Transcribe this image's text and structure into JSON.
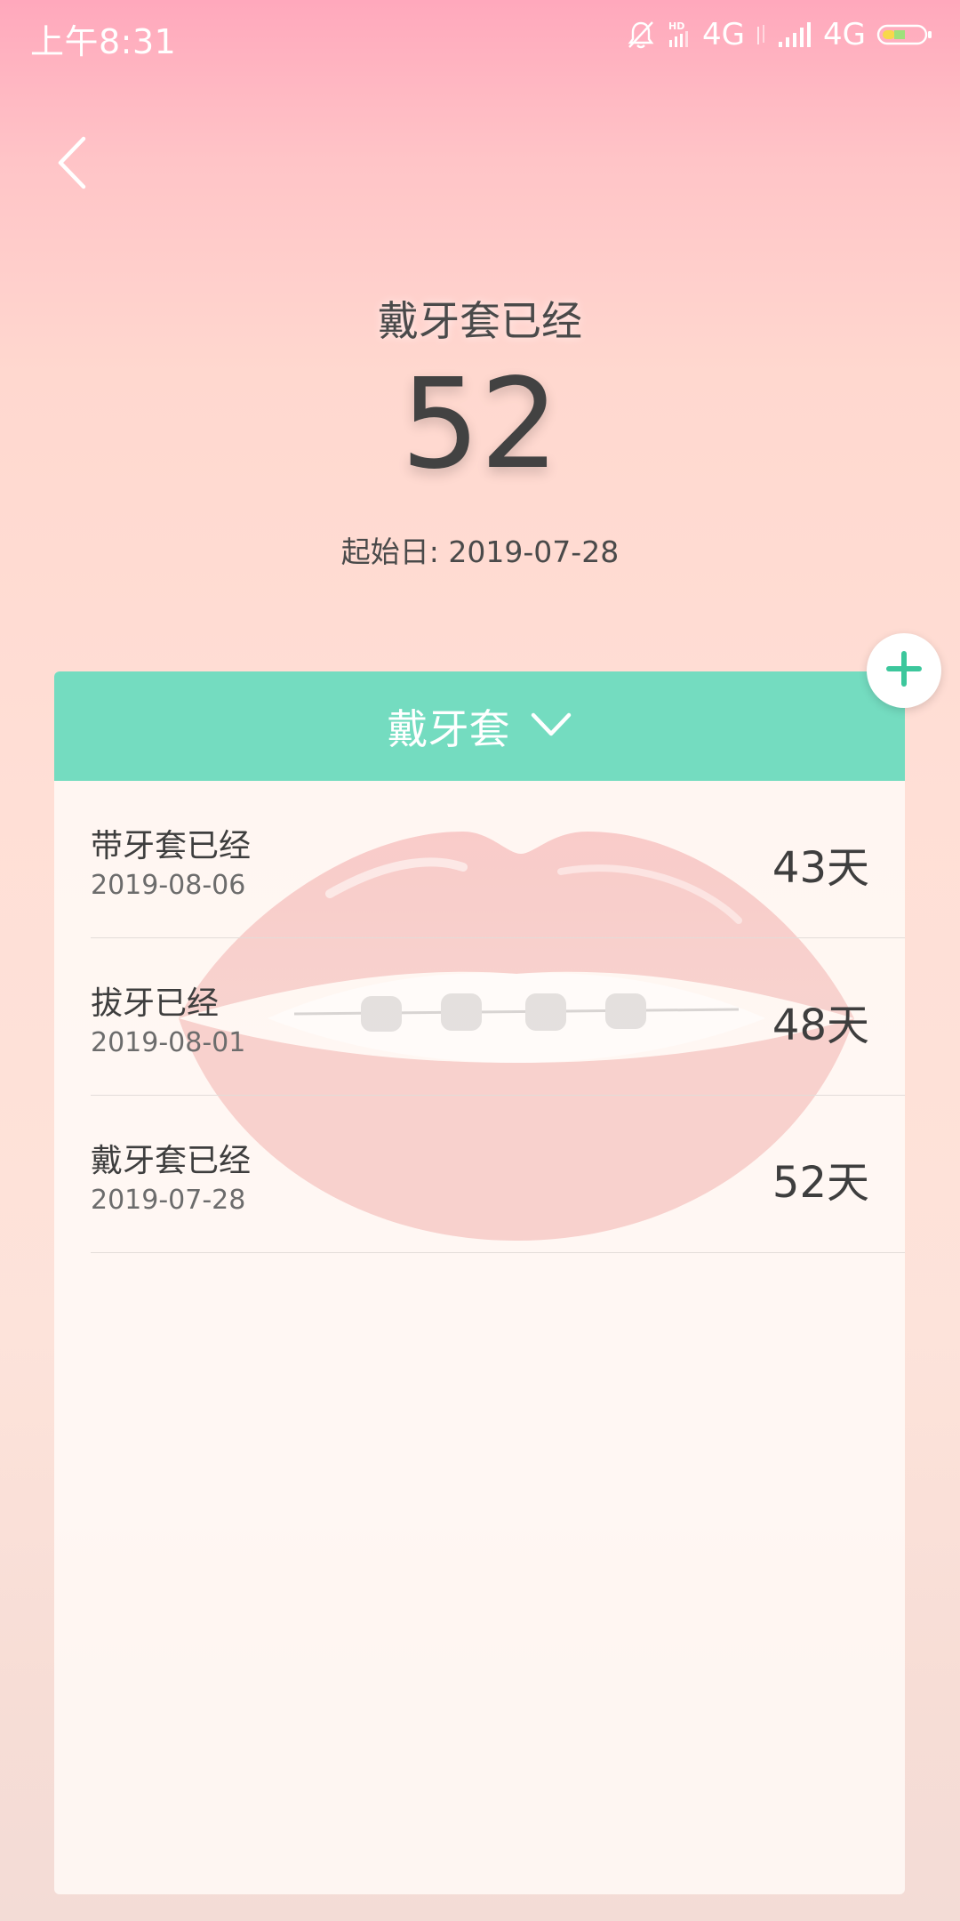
{
  "status_bar": {
    "time": "上午8:31",
    "network_1": "4G",
    "network_2": "4G"
  },
  "header": {
    "label": "戴牙套已经",
    "count": "52",
    "start_date": "起始日: 2019-07-28"
  },
  "card": {
    "title": "戴牙套",
    "items": [
      {
        "title": "带牙套已经",
        "date": "2019-08-06",
        "days": "43天"
      },
      {
        "title": "拔牙已经",
        "date": "2019-08-01",
        "days": "48天"
      },
      {
        "title": "戴牙套已经",
        "date": "2019-07-28",
        "days": "52天"
      }
    ]
  },
  "colors": {
    "accent": "#74dcc0",
    "add_icon": "#3cc79c"
  },
  "icons": {
    "back": "chevron-left-icon",
    "dropdown": "chevron-down-icon",
    "add": "plus-icon",
    "mute": "bell-off-icon"
  }
}
